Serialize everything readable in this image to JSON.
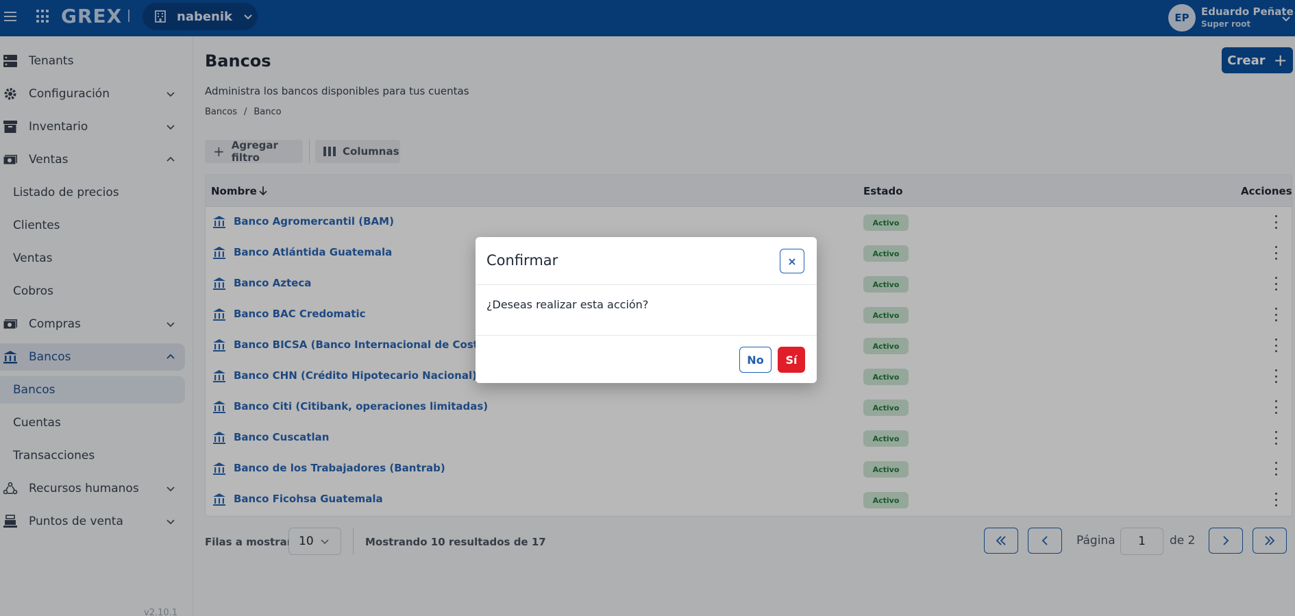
{
  "header": {
    "brand": "GREX",
    "tenant": "nabenik",
    "user": {
      "initials": "EP",
      "name": "Eduardo Peñate",
      "role": "Super root"
    }
  },
  "sidebar": {
    "items": [
      {
        "label": "Tenants",
        "icon": "server-icon"
      },
      {
        "label": "Configuración",
        "icon": "gear-icon"
      },
      {
        "label": "Inventario",
        "icon": "archive-icon"
      },
      {
        "label": "Ventas",
        "icon": "money-icon"
      },
      {
        "label": "Compras",
        "icon": "money-icon"
      },
      {
        "label": "Bancos",
        "icon": "bank-icon"
      },
      {
        "label": "Recursos humanos",
        "icon": "people-icon"
      },
      {
        "label": "Puntos de venta",
        "icon": "register-icon"
      }
    ],
    "ventas_sub": [
      "Listado de precios",
      "Clientes",
      "Ventas",
      "Cobros"
    ],
    "bancos_sub": [
      "Bancos",
      "Cuentas",
      "Transacciones"
    ],
    "version": "v2.10.1"
  },
  "main": {
    "title": "Bancos",
    "subtitle": "Administra los bancos disponibles para tus cuentas",
    "breadcrumb": [
      "Bancos",
      "/",
      "Banco"
    ],
    "create_label": "Crear",
    "toolbar": {
      "add_filter": "Agregar filtro",
      "columns": "Columnas"
    },
    "table": {
      "headers": {
        "name": "Nombre",
        "status": "Estado",
        "actions": "Acciones"
      },
      "rows": [
        {
          "name": "Banco Agromercantil (BAM)",
          "status": "Activo"
        },
        {
          "name": "Banco Atlántida Guatemala",
          "status": "Activo"
        },
        {
          "name": "Banco Azteca",
          "status": "Activo"
        },
        {
          "name": "Banco BAC Credomatic",
          "status": "Activo"
        },
        {
          "name": "Banco BICSA (Banco Internacional de Costa Rica S",
          "status": "Activo"
        },
        {
          "name": "Banco CHN (Crédito Hipotecario Nacional)",
          "status": "Activo"
        },
        {
          "name": "Banco Citi (Citibank, operaciones limitadas)",
          "status": "Activo"
        },
        {
          "name": "Banco Cuscatlan",
          "status": "Activo"
        },
        {
          "name": "Banco de los Trabajadores (Bantrab)",
          "status": "Activo"
        },
        {
          "name": "Banco Ficohsa Guatemala",
          "status": "Activo"
        }
      ]
    },
    "pagination": {
      "rows_label": "Filas a mostrar",
      "rows_value": "10",
      "showing": "Mostrando 10 resultados de 17",
      "page_label": "Página",
      "page_value": "1",
      "of_label": "de 2"
    }
  },
  "modal": {
    "title": "Confirmar",
    "close": "×",
    "message": "¿Deseas realizar esta acción?",
    "no": "No",
    "yes": "Sí"
  }
}
